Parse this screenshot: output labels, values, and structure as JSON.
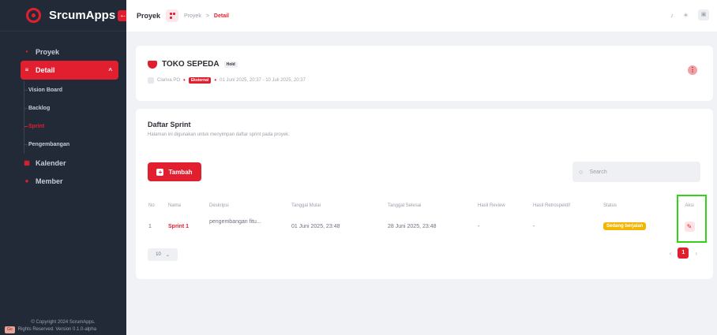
{
  "brand": {
    "name": "SrcumApps"
  },
  "sidebar": {
    "items": [
      {
        "label": "Proyek"
      },
      {
        "label": "Detail"
      },
      {
        "label": "Kalender"
      },
      {
        "label": "Member"
      }
    ],
    "sub_items": [
      {
        "label": "Vision Board"
      },
      {
        "label": "Backlog"
      },
      {
        "label": "Sprint"
      },
      {
        "label": "Pengembangan"
      }
    ],
    "copyright_line1": "© Copyright 2024 ScrumApps.",
    "copyright_line2": "Rights Reserved. Version 0.1.0-alpha",
    "copyright_badge": "Go"
  },
  "topbar": {
    "title": "Proyek",
    "breadcrumb": [
      "Proyek",
      "Detail"
    ],
    "separator": ">"
  },
  "project": {
    "name": "TOKO SEPEDA",
    "status": "Hold",
    "owner": "Clariva PO",
    "type": "Eksternal",
    "period": "01 Juni 2025, 20:37 - 10 Juli 2025, 20:37"
  },
  "sprint_section": {
    "title": "Daftar Sprint",
    "subtitle": "Halaman ini digunakan untuk menyimpan daftar sprint pada proyek.",
    "add_label": "Tambah",
    "search_placeholder": "Search",
    "columns": [
      "No",
      "Nama",
      "Deskripsi",
      "Tanggal Mulai",
      "Tanggal Selesai",
      "Hasil Review",
      "Hasil Retrospektif",
      "Status",
      "Aksi"
    ],
    "rows": [
      {
        "no": "1",
        "nama": "Sprint 1",
        "deskripsi": "pengembangan fitu...",
        "mulai": "01 Juni 2025, 23:48",
        "selesai": "28 Juni 2025, 23:48",
        "review": "-",
        "retro": "-",
        "status": "Sedang berjalan"
      }
    ],
    "page_size": "10",
    "current_page": "1"
  },
  "colors": {
    "accent": "#e21f2f",
    "sidebar_bg": "#222a38",
    "status_warning": "#f2b705",
    "highlight": "#32d21a"
  }
}
